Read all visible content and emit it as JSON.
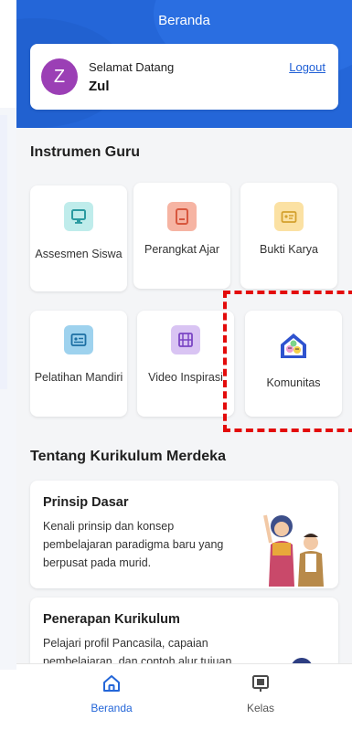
{
  "header": {
    "title": "Beranda"
  },
  "welcome": {
    "avatar_letter": "Z",
    "greeting": "Selamat Datang",
    "name": "Zul",
    "logout_label": "Logout"
  },
  "instrumen": {
    "title": "Instrumen Guru",
    "tiles": [
      {
        "label": "Assesmen Siswa",
        "icon": "monitor-icon",
        "color": "#5fc5c9"
      },
      {
        "label": "Perangkat Ajar",
        "icon": "book-icon",
        "color": "#f08a72"
      },
      {
        "label": "Bukti Karya",
        "icon": "card-icon",
        "color": "#f5c85c"
      },
      {
        "label": "Pelatihan Mandiri",
        "icon": "id-card-icon",
        "color": "#3ca3d6"
      },
      {
        "label": "Video Inspirasi",
        "icon": "film-icon",
        "color": "#9b6ad6"
      },
      {
        "label": "Komunitas",
        "icon": "community-house-icon",
        "color": "#3b5bd6"
      }
    ]
  },
  "kurikulum": {
    "title": "Tentang Kurikulum Merdeka",
    "cards": [
      {
        "title": "Prinsip Dasar",
        "desc": "Kenali prinsip dan konsep pembelajaran paradigma baru yang berpusat pada murid."
      },
      {
        "title": "Penerapan Kurikulum",
        "desc": "Pelajari profil Pancasila, capaian pembelajaran, dan contoh alur tujuan"
      }
    ]
  },
  "nav": {
    "items": [
      {
        "label": "Beranda",
        "icon": "home-icon",
        "active": true
      },
      {
        "label": "Kelas",
        "icon": "class-board-icon",
        "active": false
      }
    ]
  },
  "colors": {
    "primary": "#2466d8",
    "highlight": "#e30b0b"
  }
}
